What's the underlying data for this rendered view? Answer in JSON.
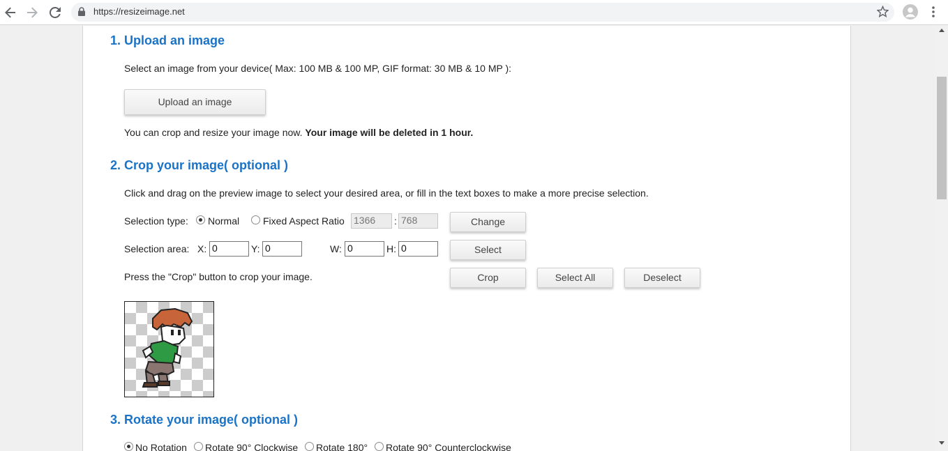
{
  "browser": {
    "url": "https://resizeimage.net"
  },
  "section1": {
    "title": "1. Upload an image",
    "description": "Select an image from your device( Max: 100 MB & 100 MP, GIF format: 30 MB & 10 MP ):",
    "upload_button": "Upload an image",
    "note_plain": "You can crop and resize your image now. ",
    "note_bold": "Your image will be deleted in 1 hour."
  },
  "section2": {
    "title": "2. Crop your image( optional )",
    "description": "Click and drag on the preview image to select your desired area, or fill in the text boxes to make a more precise selection.",
    "selection_type_label": "Selection type:",
    "radio_normal": "Normal",
    "radio_fixed": "Fixed Aspect Ratio",
    "ratio_w": "1366",
    "ratio_sep": ":",
    "ratio_h": "768",
    "change_button": "Change",
    "selection_area_label": "Selection area:",
    "x_label": "X:",
    "x_value": "0",
    "y_label": "Y:",
    "y_value": "0",
    "w_label": "W:",
    "w_value": "0",
    "h_label": "H:",
    "h_value": "0",
    "select_button": "Select",
    "crop_hint": "Press the \"Crop\" button to crop your image.",
    "crop_button": "Crop",
    "select_all_button": "Select All",
    "deselect_button": "Deselect"
  },
  "section3": {
    "title": "3. Rotate your image( optional )",
    "options": [
      "No Rotation",
      "Rotate 90° Clockwise",
      "Rotate 180°",
      "Rotate 90° Counterclockwise"
    ]
  }
}
